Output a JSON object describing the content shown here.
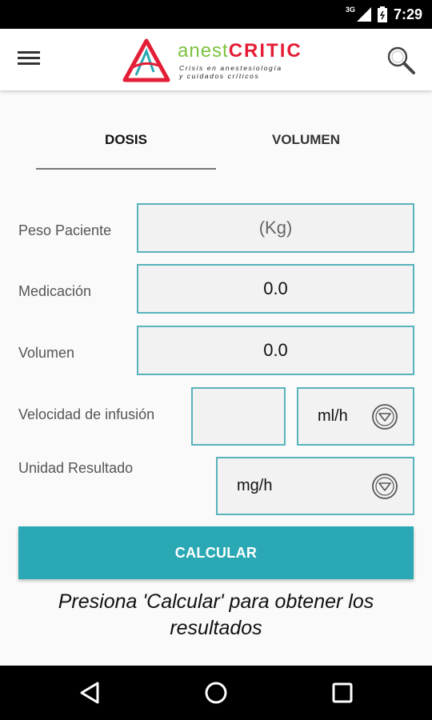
{
  "status_bar": {
    "network": "3G",
    "time": "7:29"
  },
  "app_bar": {
    "logo_word_part1": "anest",
    "logo_word_part2": "CRITIC",
    "logo_tagline_line1": "Crisis en anestesiología",
    "logo_tagline_line2": "y cuidados críticos",
    "menu_icon": "hamburger-menu-icon",
    "search_icon": "search-icon"
  },
  "tabs": [
    {
      "label": "DOSIS",
      "selected": true
    },
    {
      "label": "VOLUMEN",
      "selected": false
    }
  ],
  "form": {
    "peso": {
      "label": "Peso Paciente",
      "placeholder": "(Kg)",
      "value": ""
    },
    "medicacion": {
      "label": "Medicación",
      "value": "0.0"
    },
    "volumen": {
      "label": "Volumen",
      "value": "0.0"
    },
    "velocidad": {
      "label": "Velocidad de infusión",
      "value": "",
      "unit": "ml/h"
    },
    "unidad": {
      "label": "Unidad Resultado",
      "value": "mg/h"
    }
  },
  "calculate_button": "CALCULAR",
  "hint_text": "Presiona 'Calcular' para obtener los resultados",
  "colors": {
    "accent": "#2aa9b4",
    "field_border": "#58b4bc",
    "logo_green": "#7cc242",
    "logo_red": "#e31e36"
  }
}
